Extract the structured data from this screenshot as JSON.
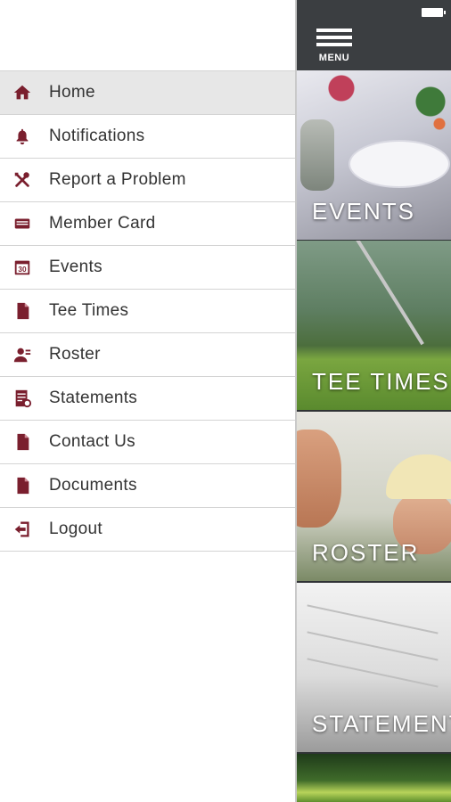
{
  "drawer": {
    "items": [
      {
        "label": "Home",
        "icon": "home-icon"
      },
      {
        "label": "Notifications",
        "icon": "bell-icon"
      },
      {
        "label": "Report a Problem",
        "icon": "tools-icon"
      },
      {
        "label": "Member Card",
        "icon": "card-icon"
      },
      {
        "label": "Events",
        "icon": "calendar-icon"
      },
      {
        "label": "Tee Times",
        "icon": "document-icon"
      },
      {
        "label": "Roster",
        "icon": "person-icon"
      },
      {
        "label": "Statements",
        "icon": "statement-icon"
      },
      {
        "label": "Contact Us",
        "icon": "document-icon"
      },
      {
        "label": "Documents",
        "icon": "document-icon"
      },
      {
        "label": "Logout",
        "icon": "logout-icon"
      }
    ],
    "active": "Home",
    "calendar_number": "30"
  },
  "panel": {
    "menu_label": "MENU",
    "tiles": [
      {
        "title": "EVENTS"
      },
      {
        "title": "TEE TIMES"
      },
      {
        "title": "ROSTER"
      },
      {
        "title": "STATEMENTS"
      }
    ]
  },
  "colors": {
    "accent": "#7a1f2e",
    "topbar": "#3b3e41",
    "active_item_bg": "#e7e7e7"
  }
}
